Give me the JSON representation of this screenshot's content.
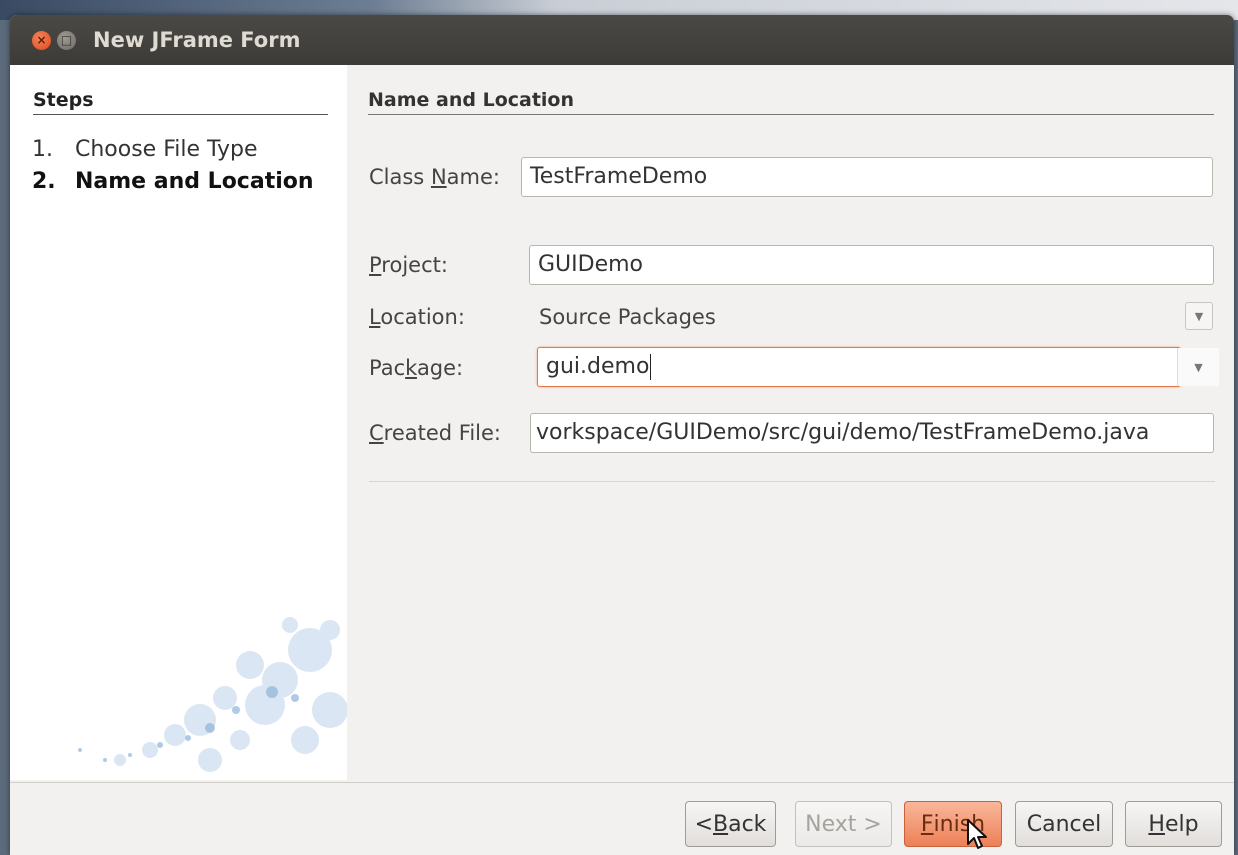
{
  "window": {
    "title": "New JFrame Form"
  },
  "steps": {
    "heading": "Steps",
    "items": [
      {
        "number": "1.",
        "label": "Choose File Type",
        "current": false
      },
      {
        "number": "2.",
        "label": "Name and Location",
        "current": true
      }
    ]
  },
  "form": {
    "section_title": "Name and Location",
    "class_name": {
      "label_pre": "Class ",
      "label_mn": "N",
      "label_post": "ame:",
      "value": "TestFrameDemo"
    },
    "project": {
      "label_mn": "P",
      "label_post": "roject:",
      "value": "GUIDemo"
    },
    "location": {
      "label_mn": "L",
      "label_post": "ocation:",
      "value": "Source Packages"
    },
    "package": {
      "label_pre": "Pac",
      "label_mn": "k",
      "label_post": "age:",
      "value": "gui.demo"
    },
    "created_file": {
      "label_mn": "C",
      "label_post": "reated File:",
      "value": "vorkspace/GUIDemo/src/gui/demo/TestFrameDemo.java"
    }
  },
  "buttons": {
    "back": {
      "pre": "< ",
      "mn": "B",
      "post": "ack",
      "enabled": true
    },
    "next": {
      "label": "Next >",
      "enabled": false
    },
    "finish": {
      "pre": "",
      "mn": "F",
      "post": "inish",
      "enabled": true,
      "default": true
    },
    "cancel": {
      "label": "Cancel",
      "enabled": true
    },
    "help": {
      "pre": "",
      "mn": "H",
      "post": "elp",
      "enabled": true
    }
  },
  "icons": {
    "close": "close-icon",
    "maximize": "maximize-icon",
    "dropdown": "chevron-down-icon",
    "pointer": "mouse-pointer-icon"
  },
  "colors": {
    "titlebar": "#3c3b37",
    "close_button": "#df4a16",
    "default_button": "#ec8058",
    "focus_border": "#e07a4c"
  }
}
